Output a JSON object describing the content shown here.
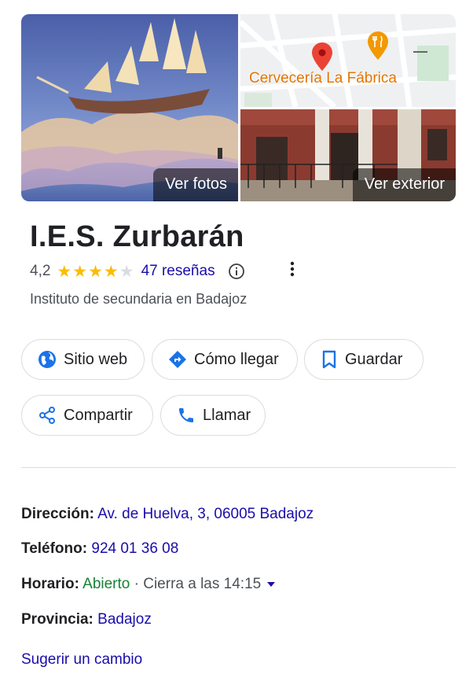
{
  "photos": {
    "main_label": "Ver fotos",
    "exterior_label": "Ver exterior",
    "map_place_label": "Cervecería La Fábrica"
  },
  "place": {
    "name": "I.E.S. Zurbarán",
    "rating": "4,2",
    "rating_value": 4.2,
    "reviews_link": "47 reseñas",
    "category": "Instituto de secundaria en Badajoz"
  },
  "actions": {
    "website": "Sitio web",
    "directions": "Cómo llegar",
    "save": "Guardar",
    "share": "Compartir",
    "call": "Llamar"
  },
  "details": {
    "address_label": "Dirección:",
    "address": "Av. de Huelva, 3, 06005 Badajoz",
    "phone_label": "Teléfono:",
    "phone": "924 01 36 08",
    "hours_label": "Horario:",
    "hours_status": "Abierto",
    "hours_close": "Cierra a las 14:15",
    "province_label": "Provincia:",
    "province": "Badajoz"
  },
  "suggest_edit": "Sugerir un cambio",
  "colors": {
    "link": "#1a0dab",
    "open": "#188038",
    "star": "#fbbc04",
    "icon_blue": "#1a73e8",
    "map_label": "#e37400"
  }
}
